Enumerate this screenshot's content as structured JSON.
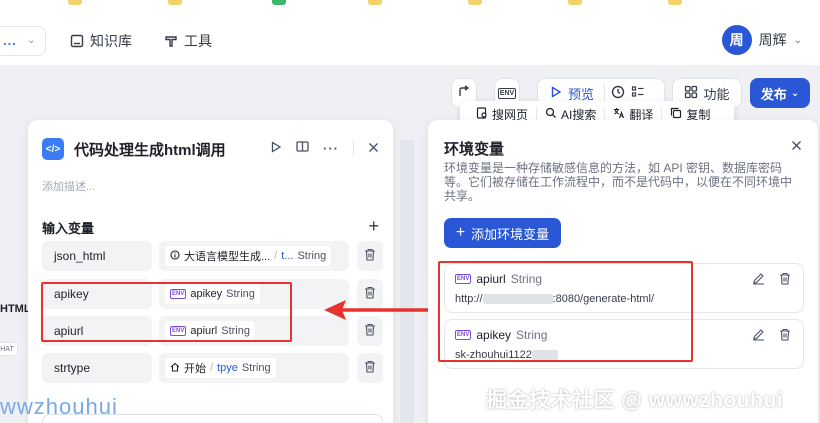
{
  "header": {
    "workspace_dots": "...",
    "nav": [
      {
        "label": "知识库",
        "icon": "book-icon"
      },
      {
        "label": "工具",
        "icon": "tool-icon"
      }
    ],
    "user": {
      "avatar_text": "周",
      "name": "周辉"
    }
  },
  "toolbar": {
    "env_badge": "ENV",
    "preview_label": "预览",
    "features_label": "功能",
    "publish_label": "发布"
  },
  "quick_bar": {
    "items": [
      {
        "label": "搜网页",
        "icon": "globe-search-icon"
      },
      {
        "label": "AI搜索",
        "icon": "search-icon"
      },
      {
        "label": "翻译",
        "icon": "translate-icon"
      },
      {
        "label": "复制",
        "icon": "copy-icon"
      }
    ]
  },
  "canvas": {
    "node_label_fragment": "HTML",
    "chip_fragment": "HAT"
  },
  "node_panel": {
    "icon_text": "</>",
    "title": "代码处理生成html调用",
    "description_placeholder": "添加描述...",
    "inputs_title": "输入变量",
    "inputs": [
      {
        "name": "json_html",
        "icon": "info-icon",
        "source": "大语言模型生成...",
        "field": "t...",
        "type": "String"
      },
      {
        "name": "apikey",
        "icon": "env-icon",
        "source": "",
        "field": "apikey",
        "type": "String"
      },
      {
        "name": "apiurl",
        "icon": "env-icon",
        "source": "",
        "field": "apiurl",
        "type": "String"
      },
      {
        "name": "strtype",
        "icon": "home-icon",
        "source": "开始",
        "field": "tpye",
        "type": "String"
      }
    ]
  },
  "env_panel": {
    "title": "环境变量",
    "description": "环境变量是一种存储敏感信息的方法，如 API 密钥、数据库密码等。它们被存储在工作流程中，而不是代码中，以便在不同环境中共享。",
    "add_button": "添加环境变量",
    "variables": [
      {
        "name": "apiurl",
        "type": "String",
        "value_prefix": "http://",
        "value_suffix": ":8080/generate-html/"
      },
      {
        "name": "apikey",
        "type": "String",
        "value_prefix": "sk-zhouhui1122",
        "value_suffix": ""
      }
    ]
  },
  "watermarks": {
    "right": "掘金技术社区 @ wwwzhouhui",
    "left": "wwzhouhui"
  },
  "colors": {
    "primary": "#2a57d6",
    "annotation_red": "#e8322e",
    "env_purple": "#7c4ddb"
  }
}
